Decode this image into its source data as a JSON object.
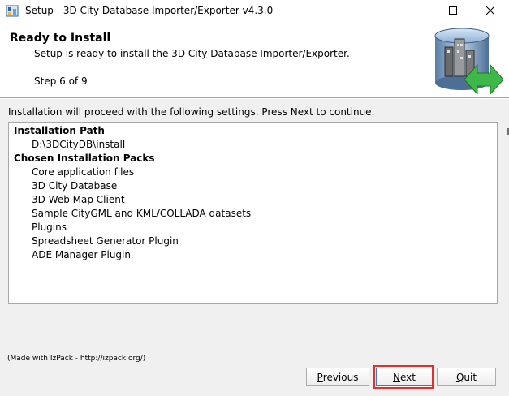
{
  "window": {
    "title": "Setup - 3D City Database Importer/Exporter v4.3.0"
  },
  "header": {
    "title": "Ready to Install",
    "subtitle": "Setup is ready to install the 3D City Database Importer/Exporter.",
    "step": "Step 6 of 9"
  },
  "intro": "Installation will proceed with the following settings. Press Next to continue.",
  "summary": {
    "path_heading": "Installation Path",
    "path_value": "D:\\3DCityDB\\install",
    "packs_heading": "Chosen Installation Packs",
    "packs": [
      "Core application files",
      "3D City Database",
      "3D Web Map Client",
      "Sample CityGML and KML/COLLADA datasets",
      "Plugins",
      "Spreadsheet Generator Plugin",
      "ADE Manager Plugin"
    ]
  },
  "footer_note": "(Made with IzPack - http://izpack.org/)",
  "buttons": {
    "previous_first": "P",
    "previous_rest": "revious",
    "next_first": "N",
    "next_rest": "ext",
    "quit_first": "Q",
    "quit_rest": "uit"
  },
  "icons": {
    "app": "installer-icon",
    "minimize": "minimize-icon",
    "maximize": "maximize-icon",
    "close": "close-icon",
    "logo": "3d-city-database-logo"
  },
  "colors": {
    "highlight": "#e03030",
    "accent": "#3c7fb1"
  }
}
